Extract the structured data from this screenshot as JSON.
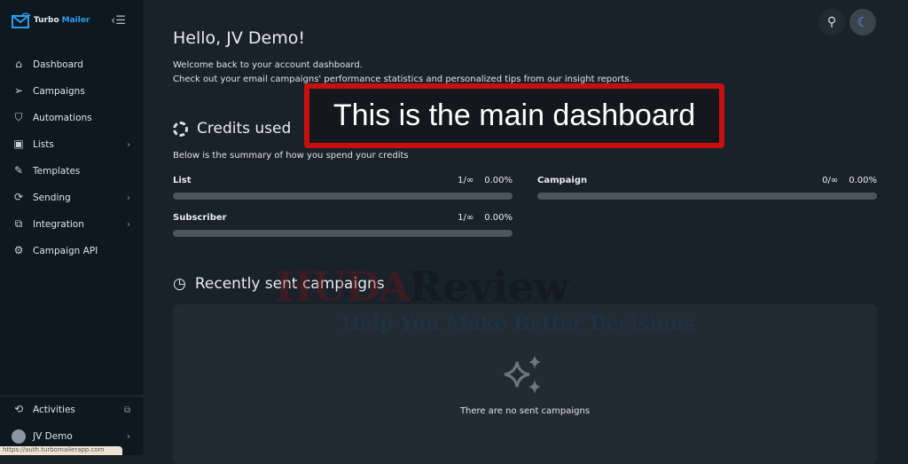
{
  "app": {
    "brand_part1": "Turbo",
    "brand_part2": "Mailer"
  },
  "sidebar": {
    "items": [
      {
        "label": "Dashboard",
        "icon": "home-icon",
        "glyph": "⌂",
        "chevron": false
      },
      {
        "label": "Campaigns",
        "icon": "send-icon",
        "glyph": "➢",
        "chevron": false
      },
      {
        "label": "Automations",
        "icon": "shield-check-icon",
        "glyph": "⛉",
        "chevron": false
      },
      {
        "label": "Lists",
        "icon": "list-icon",
        "glyph": "▣",
        "chevron": true
      },
      {
        "label": "Templates",
        "icon": "edit-icon",
        "glyph": "✎",
        "chevron": true
      },
      {
        "label": "Sending",
        "icon": "sync-icon",
        "glyph": "⟳",
        "chevron": true
      },
      {
        "label": "Integration",
        "icon": "integration-icon",
        "glyph": "⧉",
        "chevron": true
      },
      {
        "label": "Campaign API",
        "icon": "gear-icon",
        "glyph": "⚙",
        "chevron": false
      }
    ],
    "activities": "Activities",
    "user": "JV Demo",
    "status_url": "https://auth.turbomailerapp.com"
  },
  "main": {
    "greeting": "Hello, JV Demo!",
    "welcome_line1": "Welcome back to your account dashboard.",
    "welcome_line2": "Check out your email campaigns' performance statistics and personalized tips from our insight reports.",
    "credits_title": "Credits used",
    "credits_sub": "Below is the summary of how you spend your credits",
    "credits": [
      {
        "label": "List",
        "value": "1/∞",
        "percent": "0.00%",
        "fill": 0
      },
      {
        "label": "Subscriber",
        "value": "1/∞",
        "percent": "0.00%",
        "fill": 0
      },
      {
        "label": "Campaign",
        "value": "0/∞",
        "percent": "0.00%",
        "fill": 0
      }
    ],
    "recent_title": "Recently sent campaigns",
    "empty_text": "There are no sent campaigns"
  },
  "annotation": "This is the main dashboard",
  "watermark": {
    "part1": "HUDA",
    "part2": "Review",
    "tagline": "Help You Make Better Decisions"
  },
  "colors": {
    "accent": "#2d9cf0",
    "annotation_border": "#c81010"
  }
}
